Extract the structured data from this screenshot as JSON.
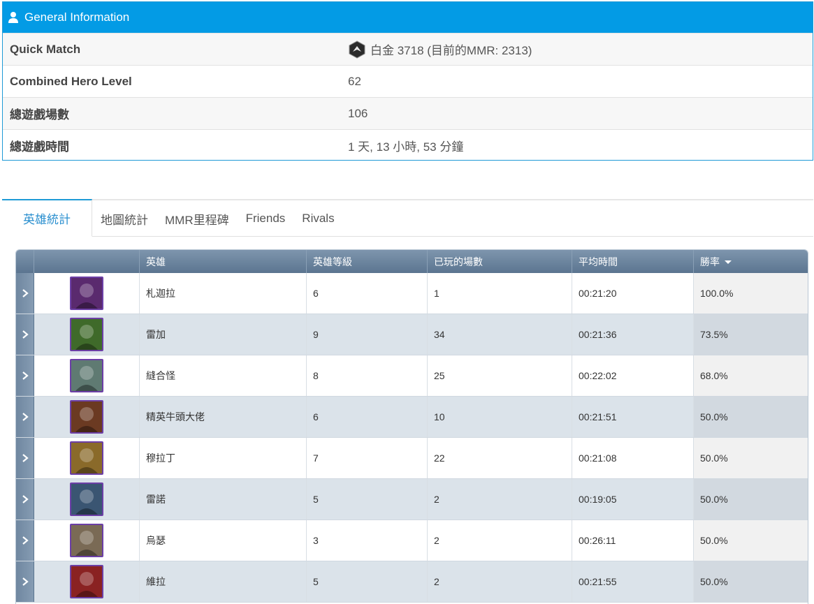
{
  "general": {
    "title": "General Information",
    "rows": [
      {
        "label": "Quick Match",
        "value": "白金 3718 (目前的MMR: 2313)"
      },
      {
        "label": "Combined Hero Level",
        "value": "62"
      },
      {
        "label": "總遊戲場數",
        "value": "106"
      },
      {
        "label": "總遊戲時間",
        "value": "1 天, 13 小時, 53 分鐘"
      }
    ]
  },
  "tabs": [
    "英雄統計",
    "地圖統計",
    "MMR里程碑",
    "Friends",
    "Rivals"
  ],
  "table": {
    "headers": [
      "英雄",
      "英雄等級",
      "已玩的場數",
      "平均時間",
      "勝率"
    ],
    "rows": [
      {
        "hero": "札迦拉",
        "level": "6",
        "games": "1",
        "avg": "00:21:20",
        "wr": "100.0%",
        "color": "#5a2a6e"
      },
      {
        "hero": "雷加",
        "level": "9",
        "games": "34",
        "avg": "00:21:36",
        "wr": "73.5%",
        "color": "#3f6a2a"
      },
      {
        "hero": "縫合怪",
        "level": "8",
        "games": "25",
        "avg": "00:22:02",
        "wr": "68.0%",
        "color": "#5f7a72"
      },
      {
        "hero": "精英牛頭大佬",
        "level": "6",
        "games": "10",
        "avg": "00:21:51",
        "wr": "50.0%",
        "color": "#6b3a22"
      },
      {
        "hero": "穆拉丁",
        "level": "7",
        "games": "22",
        "avg": "00:21:08",
        "wr": "50.0%",
        "color": "#8a6a2a"
      },
      {
        "hero": "雷諾",
        "level": "5",
        "games": "2",
        "avg": "00:19:05",
        "wr": "50.0%",
        "color": "#3a5572"
      },
      {
        "hero": "烏瑟",
        "level": "3",
        "games": "2",
        "avg": "00:26:11",
        "wr": "50.0%",
        "color": "#7a6a55"
      },
      {
        "hero": "維拉",
        "level": "5",
        "games": "2",
        "avg": "00:21:55",
        "wr": "50.0%",
        "color": "#8a2222"
      }
    ]
  }
}
